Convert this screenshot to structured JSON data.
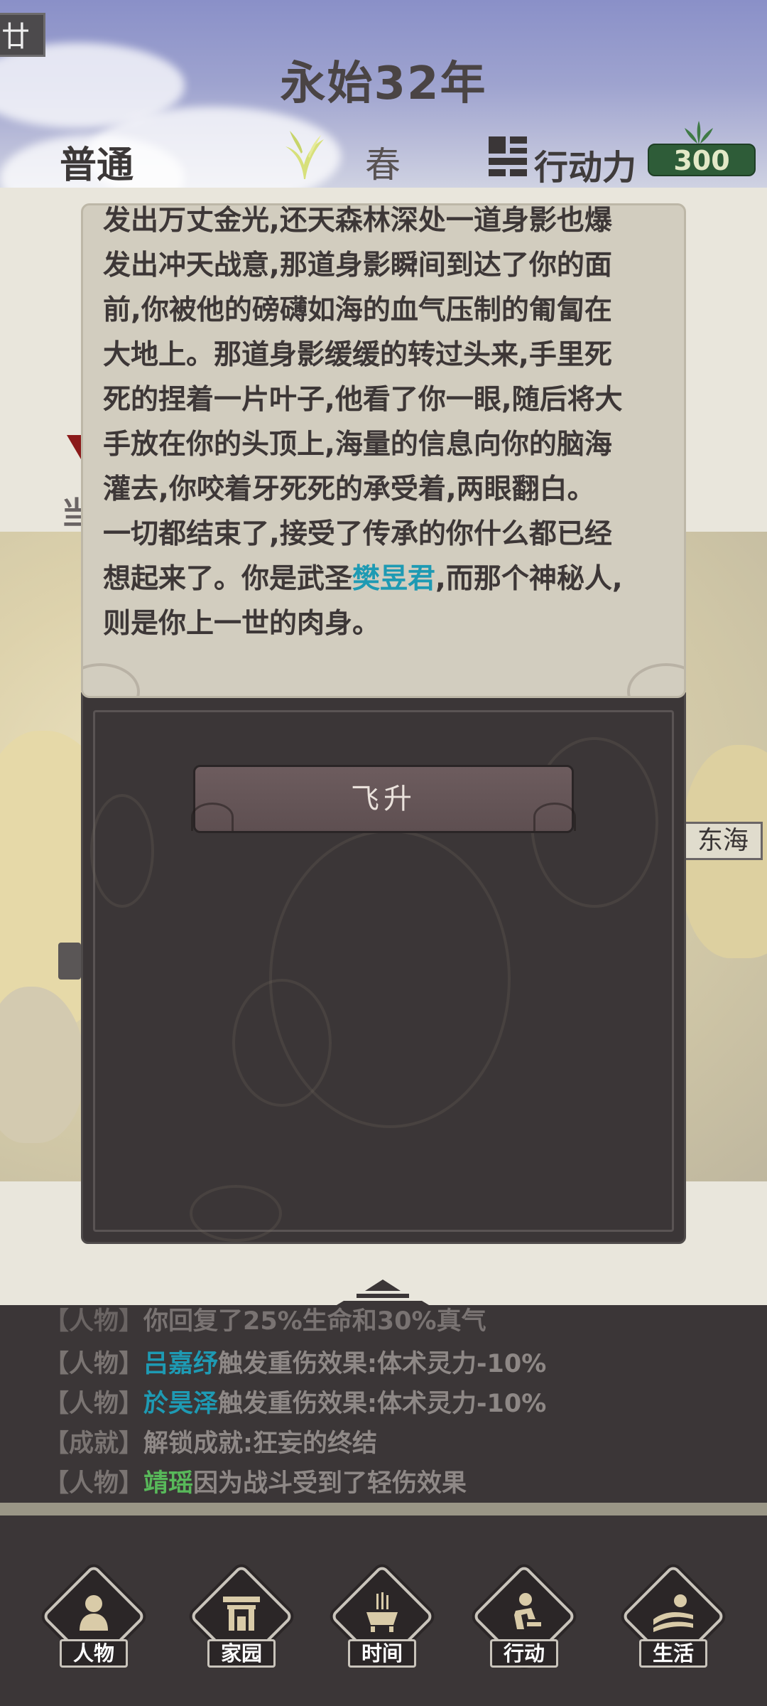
{
  "header": {
    "corner_tag": "廿",
    "year_title": "永始32年",
    "difficulty": "普通",
    "season": "春",
    "action_label": "行动力",
    "action_points": "300"
  },
  "map": {
    "sea_label": "东海",
    "cut_text": "当"
  },
  "dialog": {
    "story_before": "发出万丈金光,还天森林深处一道身影也爆\n发出冲天战意,那道身影瞬间到达了你的面\n前,你被他的磅礴如海的血气压制的匍匐在\n大地上。那道身影缓缓的转过头来,手里死\n死的捏着一片叶子,他看了你一眼,随后将大\n手放在你的头顶上,海量的信息向你的脑海\n灌去,你咬着牙死死的承受着,两眼翻白。\n一切都结束了,接受了传承的你什么都已经\n想起来了。你是武圣",
    "story_name": "樊昱君",
    "story_after": ",而那个神秘人,\n则是你上一世的肉身。",
    "ascend_button": "飞升"
  },
  "log": {
    "lines": [
      {
        "cat": "【人物】",
        "name": "",
        "text": "你回复了25%生命和30%真气",
        "name_color": ""
      },
      {
        "cat": "【人物】",
        "name": "吕嘉纾",
        "text": "触发重伤效果:体术灵力-10%",
        "name_color": "blue"
      },
      {
        "cat": "【人物】",
        "name": "於昊泽",
        "text": "触发重伤效果:体术灵力-10%",
        "name_color": "blue"
      },
      {
        "cat": "【成就】",
        "name": "",
        "text": "解锁成就:狂妄的终结",
        "name_color": ""
      },
      {
        "cat": "【人物】",
        "name": "靖瑶",
        "text": "因为战斗受到了轻伤效果",
        "name_color": "green"
      }
    ]
  },
  "nav": {
    "items": [
      {
        "label": "人物",
        "icon": "person-icon"
      },
      {
        "label": "家园",
        "icon": "home-gate-icon"
      },
      {
        "label": "时间",
        "icon": "incense-burner-icon"
      },
      {
        "label": "行动",
        "icon": "action-figure-icon"
      },
      {
        "label": "生活",
        "icon": "sun-field-icon"
      }
    ]
  },
  "colors": {
    "accent_blue": "#1e9ab3",
    "accent_green": "#58b95a",
    "panel_dark": "#3b3637",
    "action_badge": "#2e5c38"
  }
}
